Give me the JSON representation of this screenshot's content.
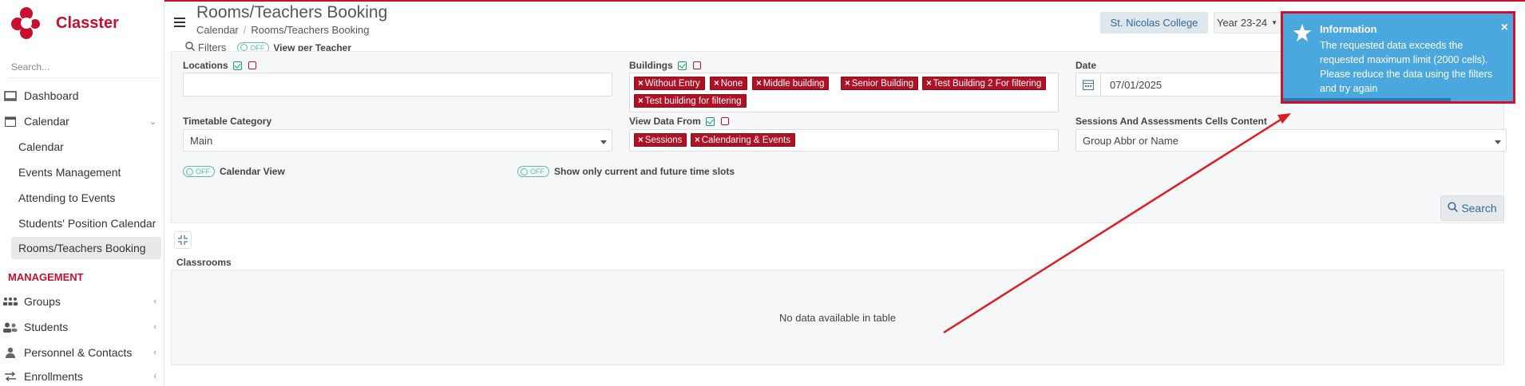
{
  "app": {
    "name": "Classter"
  },
  "sidebar": {
    "search_placeholder": "Search...",
    "dashboard": "Dashboard",
    "calendar": "Calendar",
    "calendar_items": [
      "Calendar",
      "Events Management",
      "Attending to Events",
      "Students' Position Calendar",
      "Rooms/Teachers Booking"
    ],
    "management_title": "MANAGEMENT",
    "management_items": [
      "Groups",
      "Students",
      "Personnel & Contacts",
      "Enrollments"
    ]
  },
  "header": {
    "title": "Rooms/Teachers Booking",
    "breadcrumb": [
      "Calendar",
      "Rooms/Teachers Booking"
    ],
    "college": "St. Nicolas College",
    "year": "Year 23-24"
  },
  "filters": {
    "filters_label": "Filters",
    "toggle_off": "OFF",
    "view_per_teacher": "View per Teacher",
    "locations_label": "Locations",
    "buildings_label": "Buildings",
    "buildings_tags": [
      "Without Entry",
      "None",
      "Middle building",
      "Senior Building",
      "Test Building 2 For filtering",
      "Test building for filtering"
    ],
    "date_label": "Date",
    "date_value": "07/01/2025",
    "timetable_category_label": "Timetable Category",
    "timetable_category_value": "Main",
    "view_data_from_label": "View Data From",
    "view_data_from_tags": [
      "Sessions",
      "Calendaring & Events"
    ],
    "sessions_cells_label": "Sessions And Assessments Cells Content",
    "sessions_cells_value": "Group Abbr or Name",
    "calendar_view": "Calendar View",
    "current_future": "Show only current and future time slots",
    "search_button": "Search"
  },
  "results": {
    "classrooms_label": "Classrooms",
    "no_data": "No data available in table"
  },
  "toast": {
    "title": "Information",
    "message": "The requested data exceeds the requested maximum limit (2000 cells). Please reduce the data using the filters and try again",
    "close": "×",
    "progress": 0.73
  },
  "colors": {
    "brand": "#c8102e",
    "toast": "#4aa8de",
    "tag": "#b01225"
  }
}
